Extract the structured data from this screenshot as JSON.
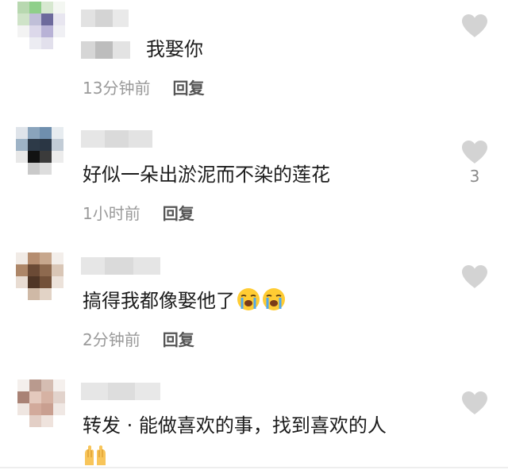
{
  "comments": [
    {
      "text": "我娶你",
      "time": "13分钟前",
      "reply_label": "回复",
      "like_count": ""
    },
    {
      "text": "好似一朵出淤泥而不染的莲花",
      "time": "1小时前",
      "reply_label": "回复",
      "like_count": "3"
    },
    {
      "text": "搞得我都像娶他了",
      "time": "2分钟前",
      "reply_label": "回复",
      "like_count": ""
    },
    {
      "text": "转发 · 能做喜欢的事，找到喜欢的人",
      "time": "",
      "reply_label": "",
      "like_count": ""
    }
  ],
  "icons": {
    "like": "heart-icon",
    "crying": "loudly-crying-face-emoji",
    "praise": "raising-hands-emoji"
  },
  "colors": {
    "heart": "#d3d3d3",
    "time": "#9a9a9a",
    "reply": "#555555",
    "text": "#1c1c1c"
  }
}
